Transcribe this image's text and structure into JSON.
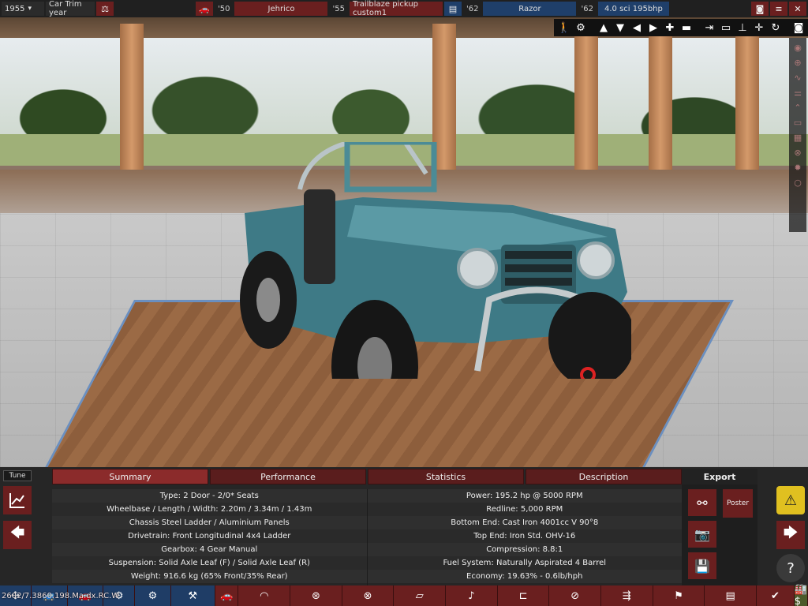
{
  "topbar": {
    "year": "1955",
    "year_dropdown_arrow": "▾",
    "trim_label": "Car Trim year",
    "engine_year_1": "'50",
    "engine_family": "Jehrico",
    "trim_year": "'55",
    "trim_name": "Trailblaze pickup custom1",
    "engine_year_2": "'62",
    "engine_name": "Razor",
    "variant_year": "'62",
    "variant_name": "4.0 sci 195bhp"
  },
  "camera_tools": [
    "walk-icon",
    "settings-icon",
    "arrow-up-icon",
    "arrow-down-icon",
    "arrow-left-icon",
    "arrow-right-icon",
    "plus-icon",
    "minus-icon",
    "align-right-icon",
    "car-icon",
    "anchor-icon",
    "center-icon",
    "rotate-icon",
    "camera-icon"
  ],
  "right_tools": [
    "eye-icon",
    "steering-icon",
    "curve-icon",
    "bars-icon",
    "chevron-icon",
    "ruler-icon",
    "grid-icon",
    "wheel-icon",
    "sun-icon",
    "ring-icon"
  ],
  "panel": {
    "tune_label": "Tune",
    "tabs": [
      "Summary",
      "Performance",
      "Statistics",
      "Description"
    ],
    "active_tab": "Summary",
    "summary_left": [
      "Type: 2 Door - 2/0* Seats",
      "Wheelbase / Length / Width: 2.20m / 3.34m / 1.43m",
      "Chassis Steel Ladder / Aluminium Panels",
      "Drivetrain: Front Longitudinal 4x4 Ladder",
      "Gearbox: 4 Gear Manual",
      "Suspension: Solid Axle Leaf (F) / Solid Axle Leaf (R)",
      "Weight: 916.6 kg (65% Front/35% Rear)"
    ],
    "summary_right": [
      "Power: 195.2 hp @ 5000 RPM",
      "Redline:  5,000 RPM",
      "Bottom End: Cast Iron 4001cc V 90°8",
      "Top End: Iron Std. OHV-16",
      "Compression: 8.8:1",
      "Fuel System: Naturally Aspirated 4 Barrel",
      "Economy: 19.63% - 0.6lb/hph"
    ],
    "export_title": "Export",
    "poster_label": "Poster"
  },
  "status_coords": "2602/7.3860.198.Ma.dx.RC.W",
  "colors": {
    "accent_red": "#6a1f1f",
    "active_tab": "#8b2b2b",
    "nav_blue": "#1f3d66",
    "warning_yellow": "#e0c020",
    "car_teal": "#3e7a86"
  }
}
